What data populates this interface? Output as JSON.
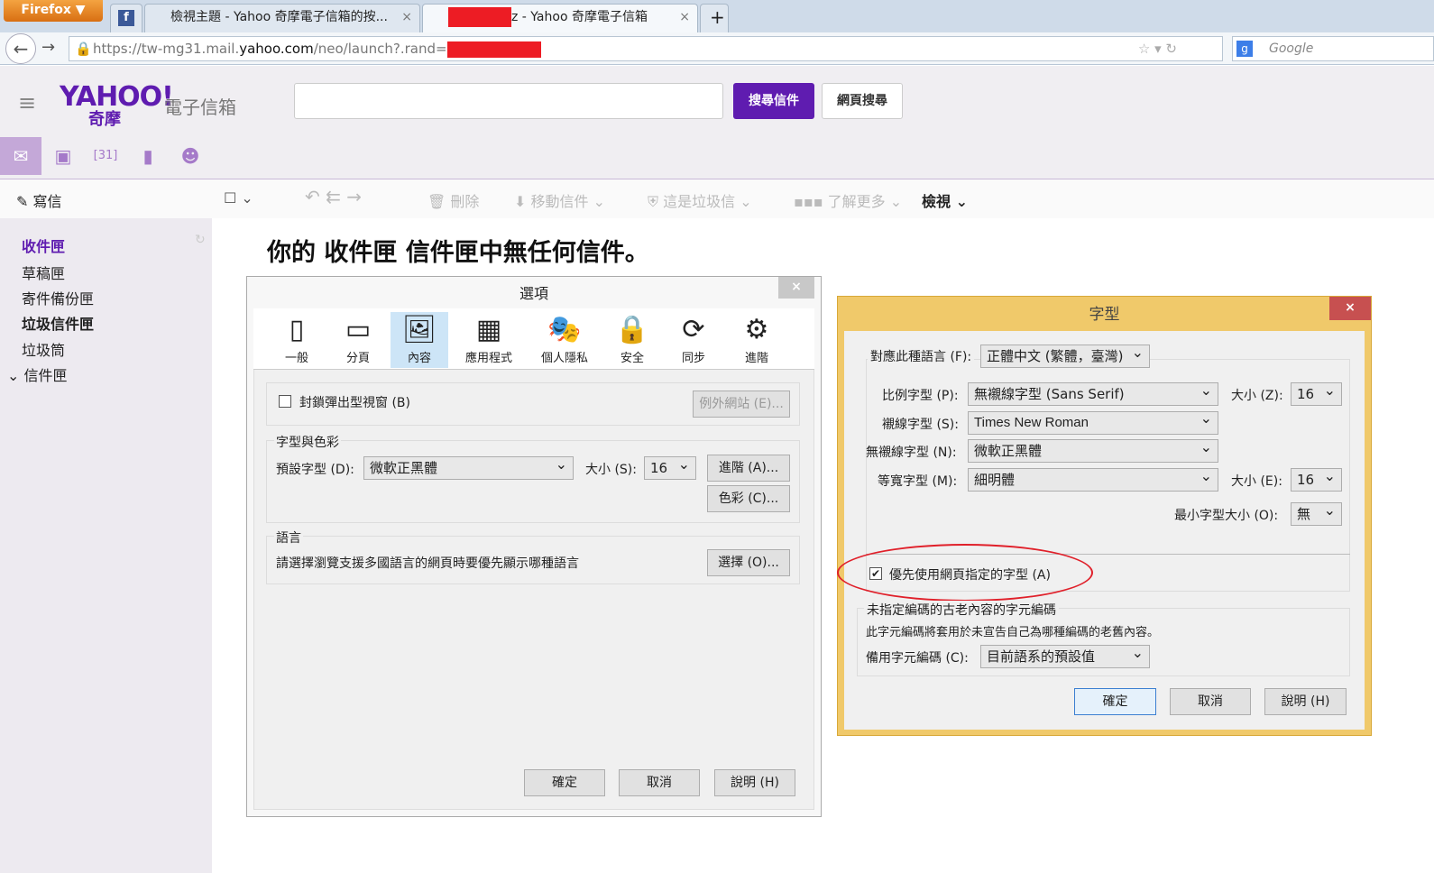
{
  "browser": {
    "menu": "Firefox ▼",
    "tabs": [
      {
        "label": "",
        "icon": "facebook-icon"
      },
      {
        "label": "檢視主題 - Yahoo 奇摩電子信箱的按...",
        "close": "×"
      },
      {
        "label": "z - Yahoo 奇摩電子信箱",
        "close": "×"
      }
    ],
    "new_tab": "+",
    "url_prefix": "https://tw-mg31.mail.",
    "url_host": "yahoo.com",
    "url_rest": "/neo/launch?.rand=",
    "search_placeholder": "Google"
  },
  "header": {
    "logo": "YAHOO!",
    "logo_sub": "奇摩",
    "product": "電子信箱",
    "search_mail": "搜尋信件",
    "search_web": "網頁搜尋"
  },
  "toolbar": {
    "compose": "寫信",
    "delete": "刪除",
    "move": "移動信件",
    "spam": "這是垃圾信",
    "more": "了解更多",
    "view": "檢視"
  },
  "sidebar": {
    "folders": [
      "收件匣",
      "草稿匣",
      "寄件備份匣",
      "垃圾信件匣",
      "垃圾筒"
    ],
    "inbox_group": "信件匣"
  },
  "main": {
    "empty": "你的 收件匣 信件匣中無任何信件。"
  },
  "options": {
    "title": "選項",
    "close": "×",
    "tabs": [
      "一般",
      "分頁",
      "內容",
      "應用程式",
      "個人隱私",
      "安全",
      "同步",
      "進階"
    ],
    "block_popup": "封鎖彈出型視窗 (B)",
    "exceptions": "例外網站 (E)...",
    "fonts_group": "字型與色彩",
    "default_font_label": "預設字型 (D):",
    "default_font": "微軟正黑體",
    "size_label": "大小 (S):",
    "size": "16",
    "advanced": "進階 (A)...",
    "colors": "色彩 (C)...",
    "lang_group": "語言",
    "lang_desc": "請選擇瀏覽支援多國語言的網頁時要優先顯示哪種語言",
    "choose": "選擇 (O)...",
    "ok": "確定",
    "cancel": "取消",
    "help": "說明 (H)"
  },
  "fonts": {
    "title": "字型",
    "close": "×",
    "lang_label": "對應此種語言 (F):",
    "lang": "正體中文 (繁體，臺灣)",
    "prop_label": "比例字型 (P):",
    "prop": "無襯線字型 (Sans Serif)",
    "size_z_label": "大小 (Z):",
    "size_z": "16",
    "serif_label": "襯線字型 (S):",
    "serif": "Times New Roman",
    "sans_label": "無襯線字型 (N):",
    "sans": "微軟正黑體",
    "mono_label": "等寬字型 (M):",
    "mono": "細明體",
    "size_e_label": "大小 (E):",
    "size_e": "16",
    "min_label": "最小字型大小 (O):",
    "min": "無",
    "allow_pages": "優先使用網頁指定的字型 (A)",
    "allow_checked": true,
    "enc_group": "未指定編碼的古老內容的字元編碼",
    "enc_desc": "此字元編碼將套用於未宣告自己為哪種編碼的老舊內容。",
    "enc_label": "備用字元編碼 (C):",
    "enc": "目前語系的預設值",
    "ok": "確定",
    "cancel": "取消",
    "help": "說明 (H)"
  }
}
